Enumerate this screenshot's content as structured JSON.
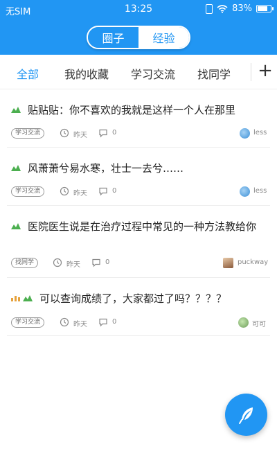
{
  "status": {
    "carrier": "无SIM",
    "time": "13:25",
    "battery": "83%"
  },
  "header": {
    "segments": [
      {
        "label": "圈子",
        "active": true
      },
      {
        "label": "经验",
        "active": false
      }
    ]
  },
  "tabs": [
    {
      "label": "全部",
      "active": true
    },
    {
      "label": "我的收藏",
      "active": false
    },
    {
      "label": "学习交流",
      "active": false
    },
    {
      "label": "找同学",
      "active": false
    }
  ],
  "add_tab_label": "+",
  "posts": [
    {
      "title": "贴贴贴：你不喜欢的我就是这样一个人在那里",
      "tag": "学习交流",
      "time": "昨天",
      "comments": "0",
      "author": "less",
      "icons": [
        "hot-icon"
      ]
    },
    {
      "title": "风萧萧兮易水寒，壮士一去兮……",
      "tag": "学习交流",
      "time": "昨天",
      "comments": "0",
      "author": "less",
      "icons": [
        "hot-icon"
      ]
    },
    {
      "title": "医院医生说是在治疗过程中常见的一种方法教给你",
      "tag": "找同学",
      "time": "昨天",
      "comments": "0",
      "author": "puckway",
      "icons": [
        "hot-icon"
      ]
    },
    {
      "title": "可以查询成绩了，大家都过了吗？？？？",
      "tag": "学习交流",
      "time": "昨天",
      "comments": "0",
      "author": "可可",
      "icons": [
        "bar-chart-icon",
        "hot-icon"
      ]
    }
  ],
  "colors": {
    "primary": "#2196f3",
    "hot": "#4caf50"
  }
}
